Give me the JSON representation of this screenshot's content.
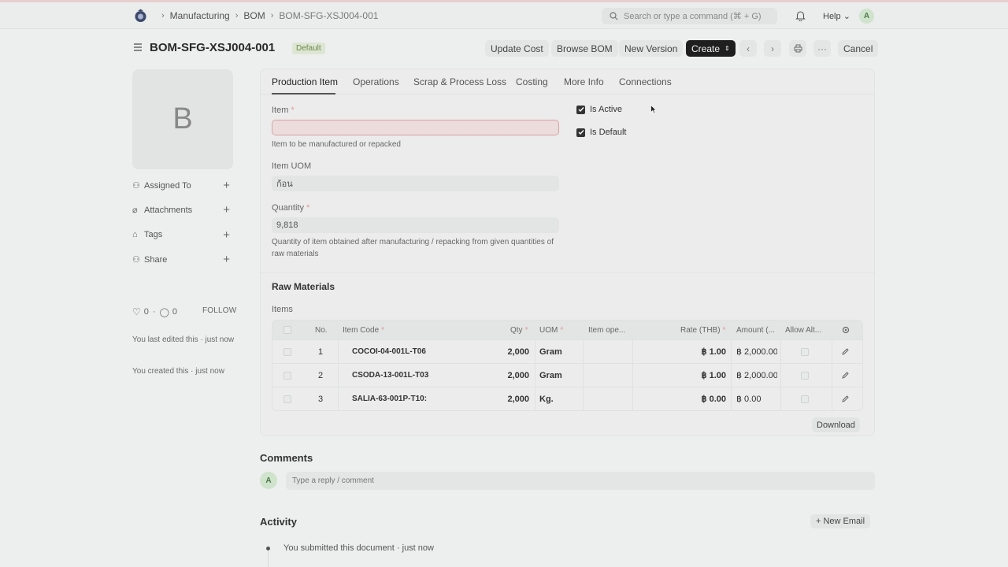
{
  "navbar": {
    "breadcrumbs": [
      "Manufacturing",
      "BOM",
      "BOM-SFG-XSJ004-001"
    ],
    "search_placeholder": "Search or type a command (⌘ + G)",
    "help_label": "Help",
    "avatar_letter": "A"
  },
  "header": {
    "title": "BOM-SFG-XSJ004-001",
    "status_badge": "Default",
    "buttons": {
      "update_cost": "Update Cost",
      "browse_bom": "Browse BOM",
      "new_version": "New Version",
      "create": "Create",
      "cancel": "Cancel"
    }
  },
  "sidebar": {
    "image_letter": "B",
    "items": [
      "Assigned To",
      "Attachments",
      "Tags",
      "Share"
    ],
    "likes": "0",
    "comments": "0",
    "follow": "FOLLOW",
    "last_edited": "You last edited this · just now",
    "created": "You created this · just now"
  },
  "tabs": [
    "Production Item",
    "Operations",
    "Scrap & Process Loss",
    "Costing",
    "More Info",
    "Connections"
  ],
  "form": {
    "item_label": "Item",
    "item_value": "",
    "item_help": "Item to be manufactured or repacked",
    "uom_label": "Item UOM",
    "uom_value": "ก้อน",
    "qty_label": "Quantity",
    "qty_value": "9,818",
    "qty_help": "Quantity of item obtained after manufacturing / repacking from given quantities of raw materials",
    "is_active_label": "Is Active",
    "is_active": true,
    "is_default_label": "Is Default",
    "is_default": true
  },
  "raw_materials": {
    "section_title": "Raw Materials",
    "table_label": "Items",
    "columns": [
      "No.",
      "Item Code",
      "Qty",
      "UOM",
      "Item ope...",
      "Rate (THB)",
      "Amount (...",
      "Allow Alt..."
    ],
    "rows": [
      {
        "no": "1",
        "item_code": "COCOI-04-001L-T06",
        "qty": "2,000",
        "uom": "Gram",
        "rate": "฿ 1.00",
        "amount": "฿ 2,000.00"
      },
      {
        "no": "2",
        "item_code": "CSODA-13-001L-T03",
        "qty": "2,000",
        "uom": "Gram",
        "rate": "฿ 1.00",
        "amount": "฿ 2,000.00"
      },
      {
        "no": "3",
        "item_code": "SALIA-63-001P-T10:",
        "qty": "2,000",
        "uom": "Kg.",
        "rate": "฿ 0.00",
        "amount": "฿ 0.00"
      }
    ],
    "download_label": "Download"
  },
  "comments": {
    "title": "Comments",
    "avatar_letter": "A",
    "placeholder": "Type a reply / comment"
  },
  "activity": {
    "title": "Activity",
    "new_email": "+ New Email",
    "entries": [
      "You submitted this document · just now"
    ]
  }
}
